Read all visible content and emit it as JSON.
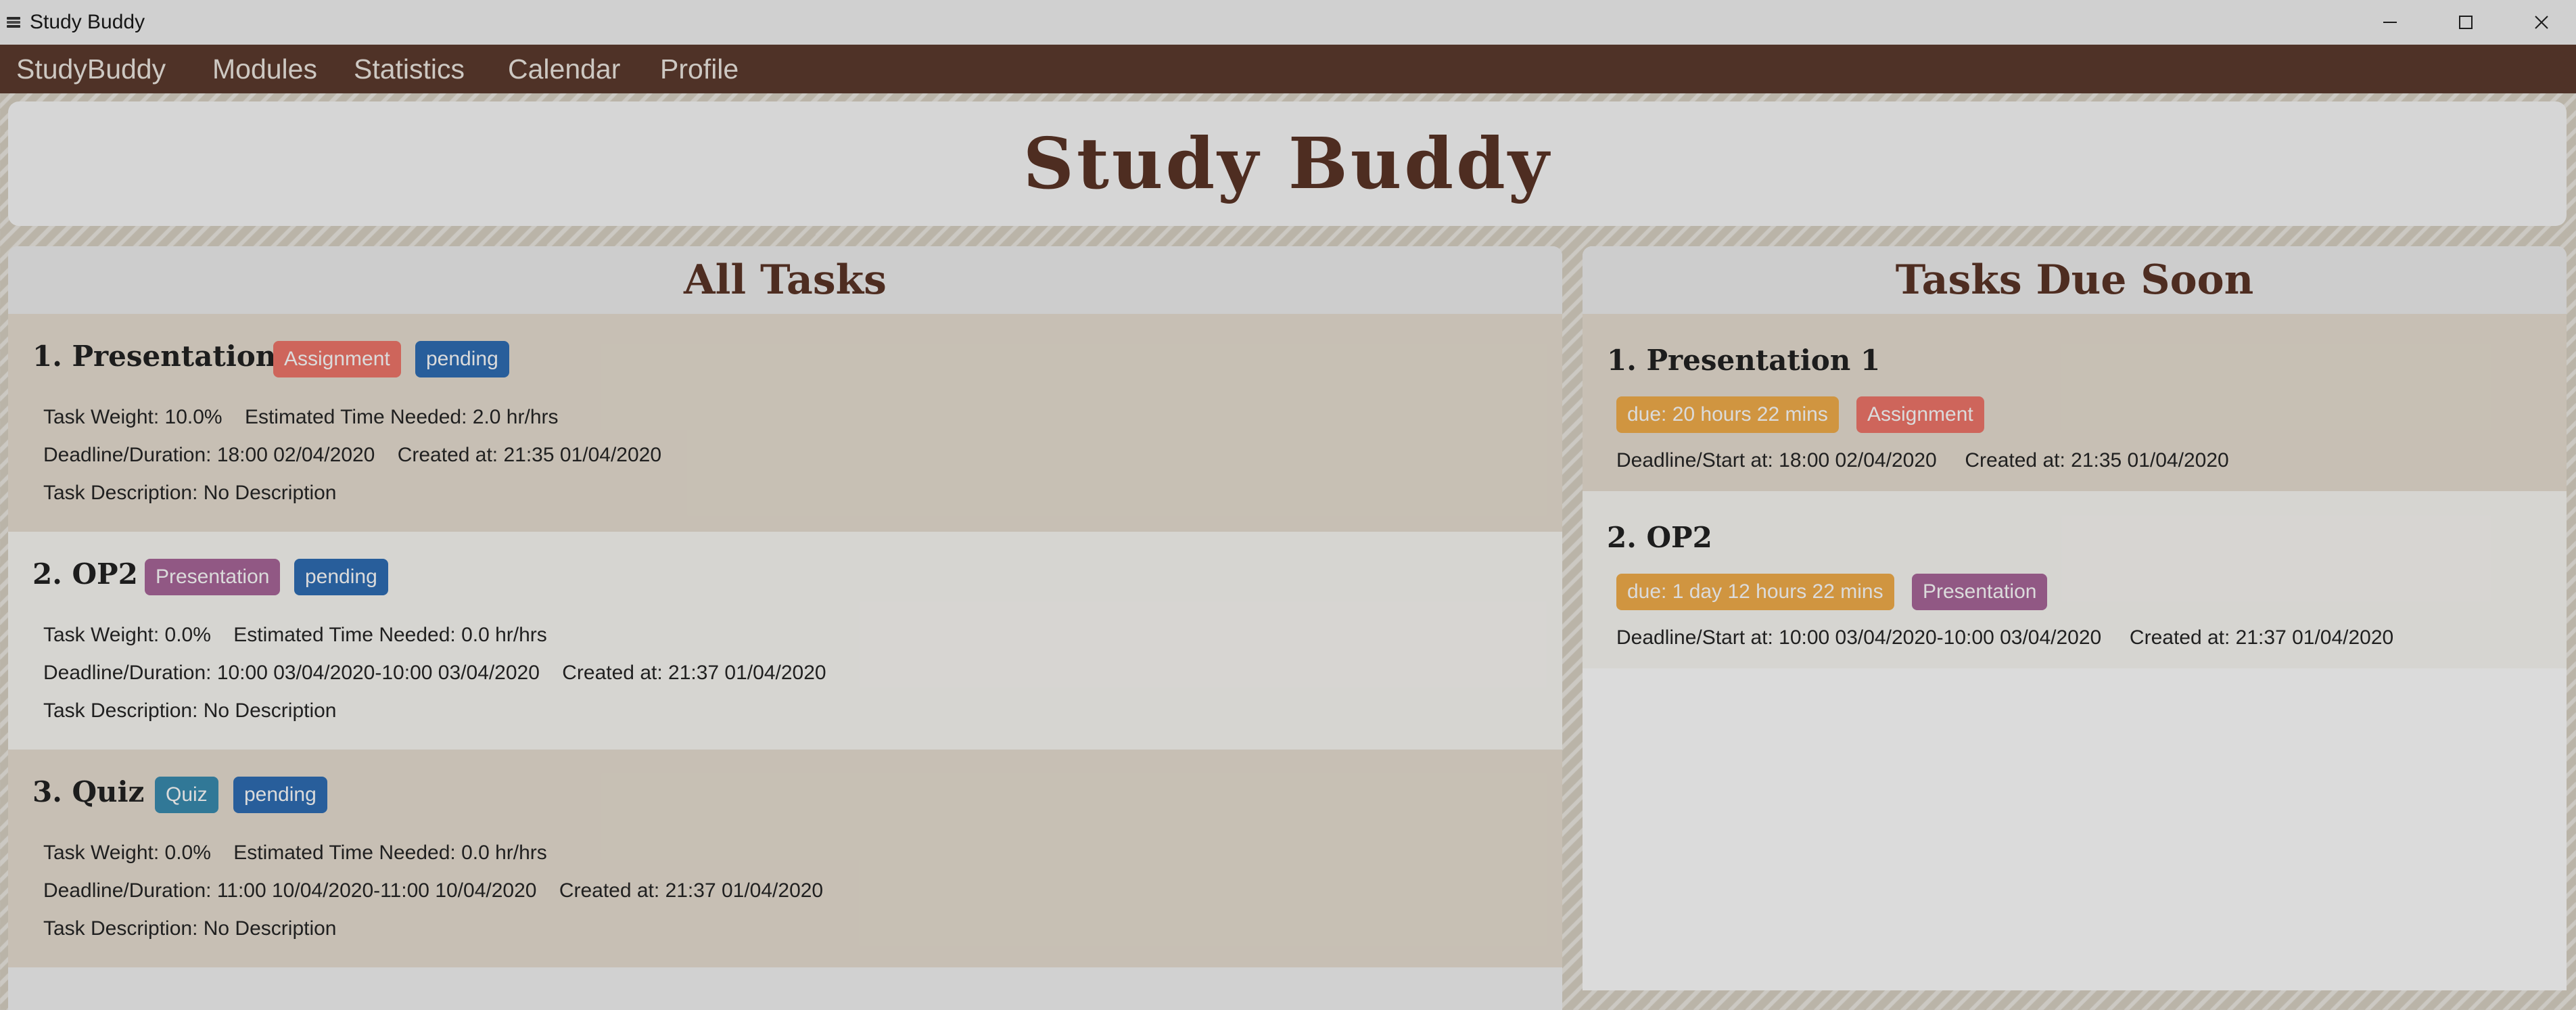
{
  "window": {
    "title": "Study Buddy",
    "icon": "stack-icon",
    "controls": [
      "minimize-icon",
      "maximize-icon",
      "close-icon"
    ]
  },
  "menu": [
    "StudyBuddy",
    "Modules",
    "Statistics",
    "Calendar",
    "Profile"
  ],
  "header": {
    "brand": "Study Buddy"
  },
  "all_tasks": {
    "title": "All Tasks",
    "items": [
      {
        "title": "1.  Presentation 1",
        "type": "Assignment",
        "status": "pending",
        "weight": "Task Weight: 10.0%",
        "time": "Estimated Time Needed: 2.0 hr/hrs",
        "deadline": "Deadline/Duration: 18:00 02/04/2020",
        "created": "Created at: 21:35 01/04/2020",
        "description": "Task Description: No Description"
      },
      {
        "title": "2.  OP2",
        "type": "Presentation",
        "status": "pending",
        "weight": "Task Weight: 0.0%",
        "time": "Estimated Time Needed: 0.0 hr/hrs",
        "deadline": "Deadline/Duration: 10:00 03/04/2020-10:00 03/04/2020",
        "created": "Created at: 21:37 01/04/2020",
        "description": "Task Description: No Description"
      },
      {
        "title": "3.  Quiz",
        "type": "Quiz",
        "status": "pending",
        "weight": "Task Weight: 0.0%",
        "time": "Estimated Time Needed: 0.0 hr/hrs",
        "deadline": "Deadline/Duration: 11:00 10/04/2020-11:00 10/04/2020",
        "created": "Created at: 21:37 01/04/2020",
        "description": "Task Description: No Description"
      }
    ]
  },
  "due_soon": {
    "title": "Tasks Due Soon",
    "items": [
      {
        "title": "1.  Presentation 1",
        "due": "due: 20 hours 22 mins",
        "type": "Assignment",
        "deadline": "Deadline/Start at: 18:00 02/04/2020",
        "created": "Created at: 21:35 01/04/2020"
      },
      {
        "title": "2.  OP2",
        "due": "due: 1 day 12 hours 22 mins",
        "type": "Presentation",
        "deadline": "Deadline/Start at: 10:00 03/04/2020-10:00 03/04/2020",
        "created": "Created at: 21:37 01/04/2020"
      }
    ]
  },
  "colors": {
    "menubar": "#5c3b2e",
    "brand_text": "#5b3527",
    "tag_assignment": "#f0766a",
    "tag_presentation": "#a9679a",
    "tag_quiz": "#3a8cb0",
    "tag_pending": "#2f6eb5",
    "tag_due": "#f3ae4b",
    "row_highlight": "#e8dfd2",
    "row_plain": "#faf8f4"
  }
}
